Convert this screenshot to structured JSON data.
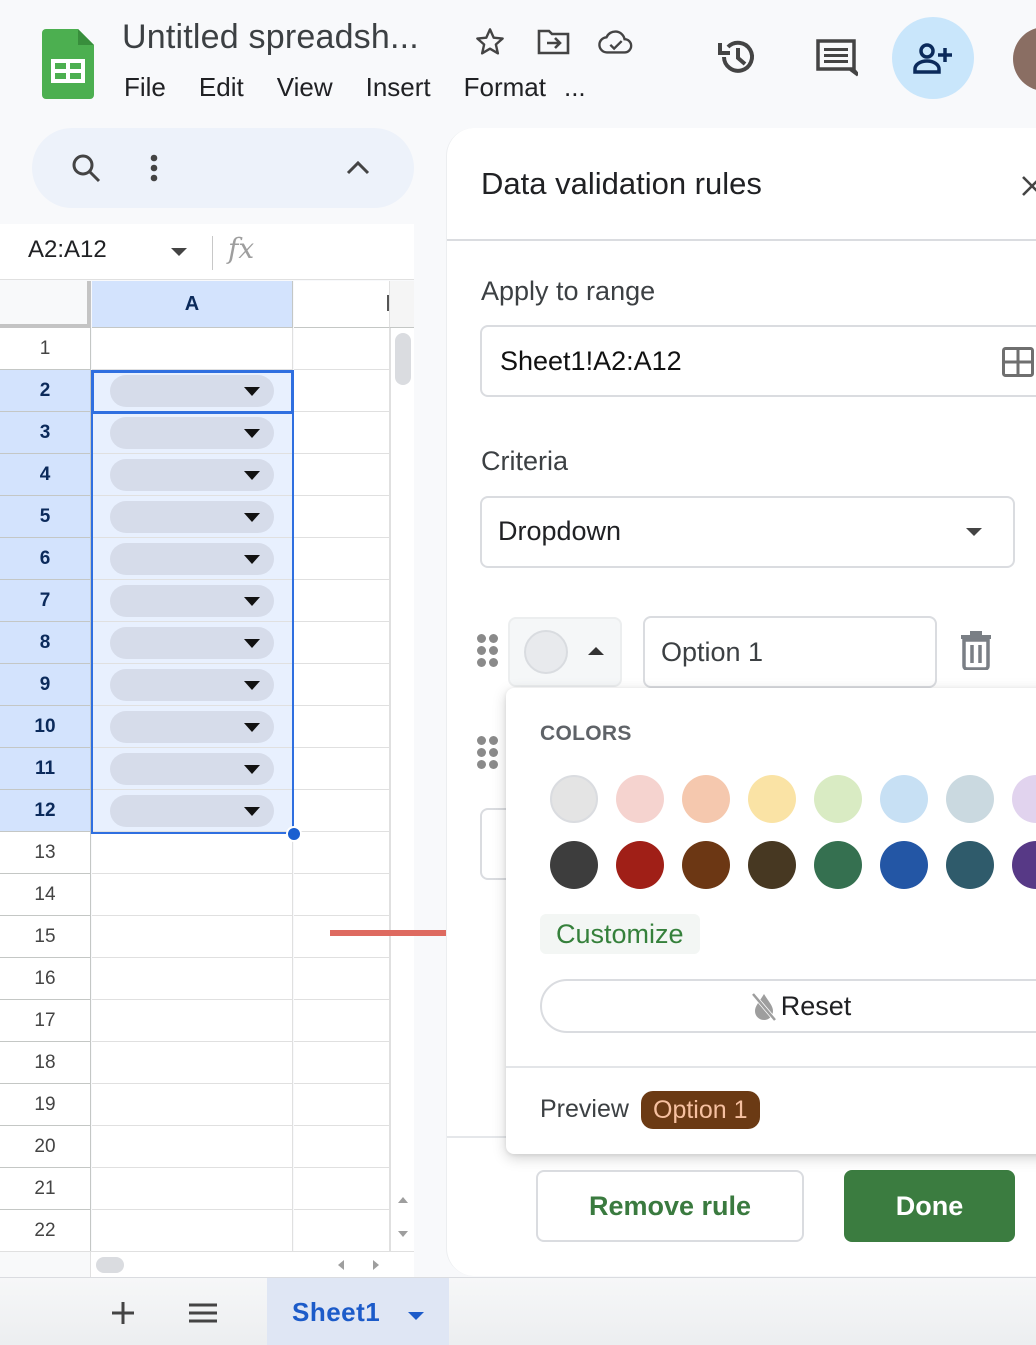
{
  "app": {
    "doc_title": "Untitled spreadsh...",
    "menu": [
      "File",
      "Edit",
      "View",
      "Insert",
      "Format",
      "..."
    ],
    "icons": {
      "logo": "google-sheets-logo",
      "star": "star-icon",
      "move": "move-to-folder-icon",
      "cloud": "cloud-saved-icon",
      "history": "version-history-icon",
      "comments": "comments-icon",
      "share": "share-person-add-icon"
    }
  },
  "toolbar": {
    "search_icon": "search-icon",
    "more_icon": "more-vert-icon",
    "collapse_icon": "chevron-up-icon"
  },
  "formula_bar": {
    "name_box": "A2:A12",
    "fx_label": "fx"
  },
  "grid": {
    "column_headers": [
      "A"
    ],
    "row_numbers": [
      "1",
      "2",
      "3",
      "4",
      "5",
      "6",
      "7",
      "8",
      "9",
      "10",
      "11",
      "12",
      "13",
      "14",
      "15",
      "16",
      "17",
      "18",
      "19",
      "20",
      "21",
      "22"
    ],
    "selected_rows": [
      "2",
      "3",
      "4",
      "5",
      "6",
      "7",
      "8",
      "9",
      "10",
      "11",
      "12"
    ],
    "dropdown_chip_rows": [
      "2",
      "3",
      "4",
      "5",
      "6",
      "7",
      "8",
      "9",
      "10",
      "11",
      "12"
    ]
  },
  "sheet_tabs": {
    "add_label": "+",
    "active_tab": "Sheet1"
  },
  "panel": {
    "title": "Data validation rules",
    "apply_to_range_label": "Apply to range",
    "range_value": "Sheet1!A2:A12",
    "criteria_label": "Criteria",
    "criteria_value": "Dropdown",
    "option_1_value": "Option 1",
    "remove_rule_label": "Remove rule",
    "done_label": "Done"
  },
  "color_popup": {
    "title": "COLORS",
    "light_colors": [
      "#e4e4e4",
      "#f5d3cf",
      "#f5c8ae",
      "#fae3a5",
      "#d9ebc3",
      "#c7e0f4",
      "#cad9e0",
      "#e1d3ee"
    ],
    "dark_colors": [
      "#3d3d3d",
      "#a01f17",
      "#6c3714",
      "#473822",
      "#357050",
      "#2356a5",
      "#2f5b6b",
      "#573986"
    ],
    "customize_label": "Customize",
    "reset_label": "Reset",
    "preview_label": "Preview",
    "preview_chip": "Option 1",
    "preview_chip_bg": "#6b3a14",
    "preview_chip_text": "#f6c0a0"
  },
  "colors": {
    "accent_green": "#3b7c40",
    "selection_blue": "#2f6fe0",
    "annotation_arrow": "#de6a60"
  }
}
